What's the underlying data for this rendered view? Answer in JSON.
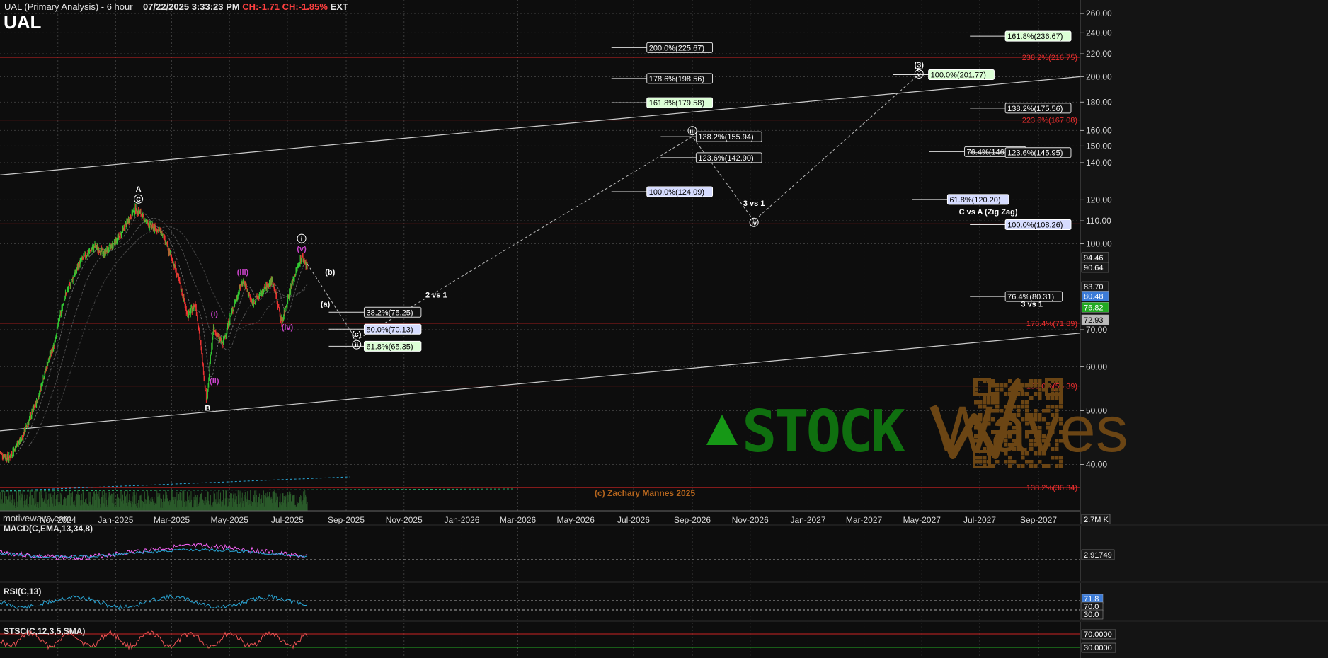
{
  "header": {
    "title": "UAL (Primary Analysis) - 6 hour",
    "datetime": "07/22/2025 3:33:23 PM",
    "change": "CH:-1.71",
    "change_pct": "CH:-1.85%",
    "session": "EXT",
    "symbol": "UAL",
    "branding": "motivewave.com",
    "copyright": "(c) Zachary Mannes 2025",
    "watermark_text": "STOCK",
    "watermark_text2": "Waves",
    "watermark_tm": "™"
  },
  "colors": {
    "background": "#0d0d0d",
    "grid": "#3a3a3a",
    "fib_red": "#cc2222",
    "up_candle": "#33cc33",
    "down_candle": "#ee3333",
    "channel": "#cccccc",
    "wave_purple": "#cc44cc",
    "macd_line": "#ff66ff",
    "rsi_line": "#2aa8d8",
    "watermark_green": "#169816",
    "watermark_brown": "#6b4514"
  },
  "chart_data": [
    {
      "type": "line",
      "title": "UAL (Primary Analysis) - 6 hour",
      "price_axis_ticks": [
        260,
        240,
        220,
        200,
        180,
        160,
        150,
        140,
        120,
        110,
        100,
        70,
        60,
        50,
        40
      ],
      "price_axis_labels": [
        "260.00",
        "240.00",
        "220.00",
        "200.00",
        "180.00",
        "160.00",
        "150.00",
        "140.00",
        "120.00",
        "110.00",
        "100.00",
        "70.00",
        "60.00",
        "50.00",
        "40.00"
      ],
      "ylim": [
        33,
        275
      ],
      "log_scale": true,
      "x_axis_labels": [
        "Nov-2024",
        "Jan-2025",
        "Mar-2025",
        "May-2025",
        "Jul-2025",
        "Sep-2025",
        "Nov-2025",
        "Jan-2026",
        "Mar-2026",
        "May-2026",
        "Jul-2026",
        "Sep-2026",
        "Nov-2026",
        "Jan-2027",
        "Mar-2027",
        "May-2027",
        "Jul-2027",
        "Sep-2027"
      ],
      "x_axis_dates": [
        "2024-11-01",
        "2025-01-01",
        "2025-03-01",
        "2025-05-01",
        "2025-07-01",
        "2025-09-01",
        "2025-11-01",
        "2026-01-01",
        "2026-03-01",
        "2026-05-01",
        "2026-07-01",
        "2026-09-01",
        "2026-11-01",
        "2027-01-01",
        "2027-03-01",
        "2027-05-01",
        "2027-07-01",
        "2027-09-01"
      ],
      "x_range": [
        "2024-09-01",
        "2027-10-15"
      ],
      "grid": true,
      "price_path": [
        [
          "2024-09-01",
          42
        ],
        [
          "2024-09-10",
          41
        ],
        [
          "2024-09-25",
          45
        ],
        [
          "2024-10-10",
          52
        ],
        [
          "2024-10-20",
          60
        ],
        [
          "2024-10-28",
          66
        ],
        [
          "2024-11-08",
          80
        ],
        [
          "2024-11-25",
          93
        ],
        [
          "2024-12-10",
          99
        ],
        [
          "2024-12-20",
          96
        ],
        [
          "2025-01-05",
          103
        ],
        [
          "2025-01-22",
          116
        ],
        [
          "2025-02-05",
          108
        ],
        [
          "2025-02-18",
          105
        ],
        [
          "2025-03-05",
          90
        ],
        [
          "2025-03-18",
          74
        ],
        [
          "2025-03-26",
          78
        ],
        [
          "2025-04-03",
          60
        ],
        [
          "2025-04-07",
          52
        ],
        [
          "2025-04-14",
          70
        ],
        [
          "2025-04-24",
          66
        ],
        [
          "2025-05-01",
          73
        ],
        [
          "2025-05-15",
          86
        ],
        [
          "2025-05-25",
          78
        ],
        [
          "2025-06-05",
          82
        ],
        [
          "2025-06-15",
          86
        ],
        [
          "2025-06-25",
          72
        ],
        [
          "2025-07-05",
          84
        ],
        [
          "2025-07-16",
          95
        ],
        [
          "2025-07-22",
          91
        ]
      ],
      "last_prices": {
        "label_1": "94.46",
        "label_2": "90.64",
        "label_3": "83.70",
        "label_4": "80.48",
        "label_5": "76.82",
        "label_6": "72.93"
      },
      "volume_label": "2.7M K",
      "projection_path": [
        [
          "2025-07-22",
          92
        ],
        [
          "2025-09-12",
          67
        ],
        [
          "2026-09-01",
          156
        ],
        [
          "2026-11-05",
          110
        ],
        [
          "2027-04-28",
          202
        ]
      ],
      "channel_upper": [
        [
          "2024-09-01",
          133
        ],
        [
          "2027-10-15",
          200
        ]
      ],
      "channel_lower": [
        [
          "2024-09-01",
          46
        ],
        [
          "2027-10-15",
          69
        ]
      ],
      "fib_lines_red": [
        {
          "price": 216.75,
          "label": "238.2%(216.75)"
        },
        {
          "price": 167.08,
          "label": "223.6%(167.08)"
        },
        {
          "price": 108.6,
          "label": ""
        },
        {
          "price": 71.89,
          "label": "176.4%(71.89)"
        },
        {
          "price": 55.39,
          "label": "150.0%(55.39)"
        },
        {
          "price": 36.34,
          "label": "138.2%(36.34)"
        }
      ],
      "fib_boxes": [
        {
          "date": "2025-09-20",
          "price": 75.25,
          "label": "38.2%(75.25)",
          "style": "plain"
        },
        {
          "date": "2025-09-20",
          "price": 70.13,
          "label": "50.0%(70.13)",
          "style": "blue"
        },
        {
          "date": "2025-09-20",
          "price": 65.35,
          "label": "61.8%(65.35)",
          "style": "green"
        },
        {
          "date": "2026-07-15",
          "price": 225.67,
          "label": "200.0%(225.67)",
          "style": "plain"
        },
        {
          "date": "2026-07-15",
          "price": 198.56,
          "label": "178.6%(198.56)",
          "style": "plain"
        },
        {
          "date": "2026-07-15",
          "price": 179.58,
          "label": "161.8%(179.58)",
          "style": "green"
        },
        {
          "date": "2026-09-05",
          "price": 155.94,
          "label": "138.2%(155.94)",
          "style": "plain"
        },
        {
          "date": "2026-09-05",
          "price": 142.9,
          "label": "123.6%(142.90)",
          "style": "plain"
        },
        {
          "date": "2026-07-15",
          "price": 124.09,
          "label": "100.0%(124.09)",
          "style": "blue"
        },
        {
          "date": "2027-05-08",
          "price": 201.77,
          "label": "100.0%(201.77)",
          "style": "green"
        },
        {
          "date": "2027-05-28",
          "price": 120.2,
          "label": "61.8%(120.20)",
          "style": "blue"
        },
        {
          "date": "2027-06-15",
          "price": 146.52,
          "label": "76.4%(146.52)",
          "style": "plain"
        },
        {
          "date": "2027-07-28",
          "price": 236.67,
          "label": "161.8%(236.67)",
          "style": "green"
        },
        {
          "date": "2027-07-28",
          "price": 175.56,
          "label": "138.2%(175.56)",
          "style": "plain"
        },
        {
          "date": "2027-07-28",
          "price": 145.95,
          "label": "123.6%(145.95)",
          "style": "plain"
        },
        {
          "date": "2027-07-28",
          "price": 108.26,
          "label": "100.0%(108.26)",
          "style": "blue"
        },
        {
          "date": "2027-07-28",
          "price": 80.31,
          "label": "76.4%(80.31)",
          "style": "plain"
        }
      ],
      "wave_labels": [
        {
          "date": "2025-01-25",
          "price": 124,
          "text": "A",
          "color": "white"
        },
        {
          "date": "2025-01-25",
          "price": 119,
          "text": "C",
          "color": "white",
          "circle": true
        },
        {
          "date": "2025-04-08",
          "price": 50,
          "text": "B",
          "color": "white"
        },
        {
          "date": "2025-07-16",
          "price": 101,
          "text": "i",
          "color": "white",
          "circle": true
        },
        {
          "date": "2025-07-16",
          "price": 97,
          "text": "(v)",
          "color": "purple"
        },
        {
          "date": "2025-05-15",
          "price": 88,
          "text": "(iii)",
          "color": "purple"
        },
        {
          "date": "2025-04-15",
          "price": 74,
          "text": "(i)",
          "color": "purple"
        },
        {
          "date": "2025-04-15",
          "price": 56,
          "text": "(ii)",
          "color": "purple"
        },
        {
          "date": "2025-07-01",
          "price": 70,
          "text": "(iv)",
          "color": "purple"
        },
        {
          "date": "2025-08-15",
          "price": 88,
          "text": "(b)",
          "color": "white"
        },
        {
          "date": "2025-08-10",
          "price": 77,
          "text": "(a)",
          "color": "white"
        },
        {
          "date": "2025-09-12",
          "price": 68,
          "text": "(c)",
          "color": "white"
        },
        {
          "date": "2025-09-12",
          "price": 65,
          "text": "ii",
          "color": "white",
          "circle": true
        },
        {
          "date": "2025-12-05",
          "price": 80,
          "text": "2 vs 1",
          "color": "white"
        },
        {
          "date": "2026-09-01",
          "price": 158,
          "text": "iii",
          "color": "white",
          "circle": true
        },
        {
          "date": "2026-11-05",
          "price": 117,
          "text": "3 vs 1",
          "color": "white"
        },
        {
          "date": "2026-11-05",
          "price": 108,
          "text": "iv",
          "color": "white",
          "circle": true
        },
        {
          "date": "2027-04-28",
          "price": 208,
          "text": "(3)",
          "color": "white"
        },
        {
          "date": "2027-04-28",
          "price": 204,
          "text": "c",
          "color": "white"
        },
        {
          "date": "2027-04-28",
          "price": 200,
          "text": "v",
          "color": "white",
          "circle": true
        },
        {
          "date": "2027-07-10",
          "price": 113,
          "text": "C vs A (Zig Zag)",
          "color": "white"
        },
        {
          "date": "2027-08-25",
          "price": 77,
          "text": "3 vs 1",
          "color": "white"
        }
      ]
    },
    {
      "type": "line",
      "title": "MACD(C,EMA,13,34,8)",
      "value_label": "2.91749"
    },
    {
      "type": "line",
      "title": "RSI(C,13)",
      "value_labels": [
        "71.8",
        "70.0",
        "30.0"
      ]
    },
    {
      "type": "line",
      "title": "STSC(C,12,3,5,SMA)",
      "value_labels": [
        "70.0000",
        "30.0000"
      ]
    }
  ]
}
